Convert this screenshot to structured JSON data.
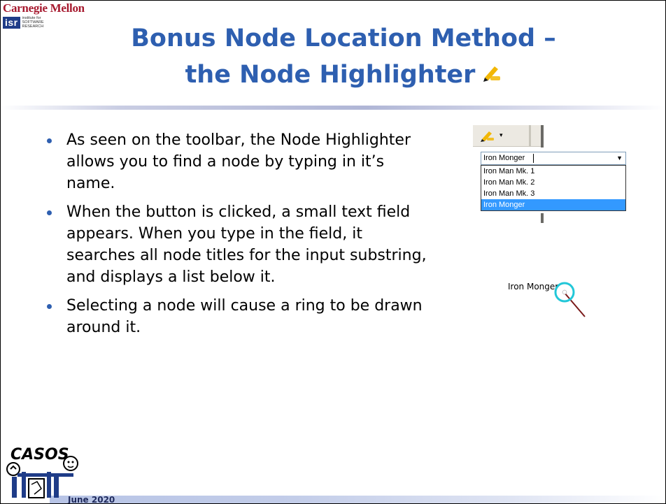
{
  "logos": {
    "cmu": "Carnegie Mellon",
    "isr": "isr",
    "isr_text": [
      "institute for",
      "SOFTWARE",
      "RESEARCH"
    ],
    "casos": "CASOS"
  },
  "title": {
    "line1": "Bonus Node Location Method –",
    "line2": "the Node Highlighter",
    "icon": "highlighter-pen-icon"
  },
  "bullets": [
    "As seen on the toolbar, the Node Highlighter allows you to find a node by typing in it’s name.",
    "When the button is clicked, a small text field appears.  When you type in the field, it searches all node titles for the input substring, and displays a list below it.",
    "Selecting a node will cause a ring to be drawn around it."
  ],
  "toolbar_shot": {
    "combo_value": "Iron Monger",
    "options": [
      "Iron Man Mk. 1",
      "Iron Man Mk. 2",
      "Iron Man Mk. 3",
      "Iron Monger"
    ],
    "selected_option": "Iron Monger"
  },
  "ring_demo": {
    "node_label": "Iron Monger",
    "ring_color": "#22c7d8",
    "edge_color": "#7a1a1a"
  },
  "footer": {
    "date": "June 2020"
  },
  "colors": {
    "title": "#2e5fb0",
    "cmu_red": "#a6192e",
    "isr_blue": "#1f3c88",
    "selection": "#3399ff"
  }
}
